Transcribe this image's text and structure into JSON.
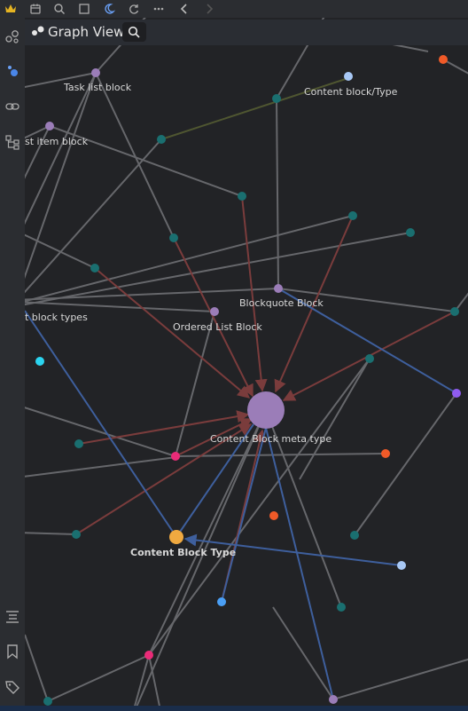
{
  "app": {
    "pane_title": "Graph View"
  },
  "toolbar": {
    "icons": [
      "crown-icon",
      "calendar-icon",
      "search-icon",
      "square-icon",
      "moon-icon",
      "refresh-icon",
      "more-icon",
      "back-icon",
      "forward-icon"
    ]
  },
  "left_rail": {
    "icons": [
      "graph-nodes-icon",
      "graph-view-icon",
      "link-icon",
      "hierarchy-icon",
      "outline-icon",
      "bookmark-icon",
      "tag-icon"
    ]
  },
  "colors": {
    "background": "#222326",
    "edge_gray": "#6b6c70",
    "edge_red": "#7a3c3c",
    "edge_blue": "#3e5f9d",
    "edge_olive": "#4f5631",
    "node_purple": "#9b7db8",
    "node_teal": "#1a6f70",
    "node_orange": "#f05a28",
    "node_pink": "#ea2b78",
    "node_gold": "#f0a940",
    "node_lightblue": "#a8c8f5",
    "node_blue": "#4a9ff5",
    "node_cyan": "#2bd4f0",
    "node_violet": "#8f5cf0"
  },
  "graph": {
    "labels": {
      "task_list_block": "Task list block",
      "content_block_type_slash": "Content block/Type",
      "list_item_block": "st item block",
      "block_types": "t block types",
      "blockquote_block": "Blockquote Block",
      "ordered_list_block": "Ordered List Block",
      "content_block_meta_type": "Content Block meta type",
      "content_block_type": "Content Block Type"
    }
  }
}
